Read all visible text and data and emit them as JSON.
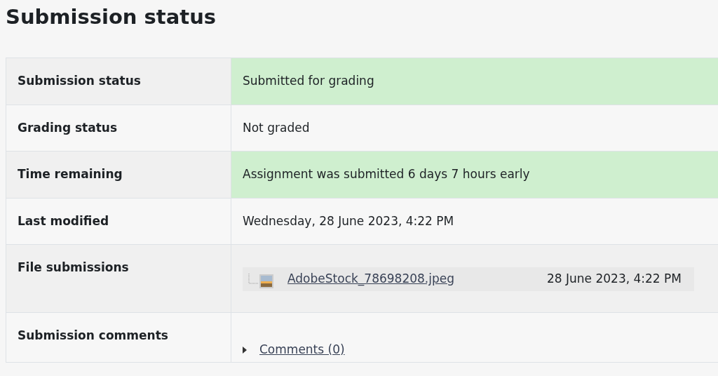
{
  "heading": "Submission status",
  "rows": [
    {
      "kind": "text",
      "label": "Submission status",
      "value": "Submitted for grading",
      "success": true
    },
    {
      "kind": "text",
      "label": "Grading status",
      "value": "Not graded",
      "success": false
    },
    {
      "kind": "text",
      "label": "Time remaining",
      "value": "Assignment was submitted 6 days 7 hours early",
      "success": true
    },
    {
      "kind": "text",
      "label": "Last modified",
      "value": "Wednesday, 28 June 2023, 4:22 PM",
      "success": false
    },
    {
      "kind": "files",
      "label": "File submissions",
      "files": [
        {
          "name": "AdobeStock_78698208.jpeg",
          "date": "28 June 2023, 4:22 PM"
        }
      ]
    },
    {
      "kind": "comments",
      "label": "Submission comments",
      "link": "Comments (0)",
      "expanded": false
    }
  ]
}
